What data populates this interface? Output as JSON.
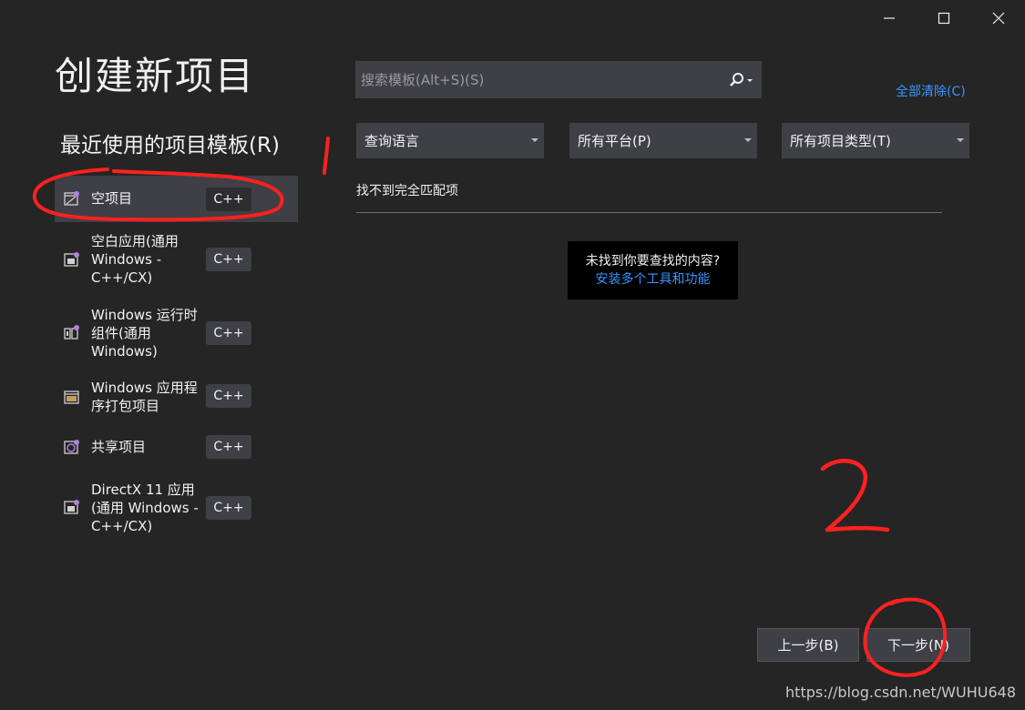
{
  "window": {
    "title": "创建新项目",
    "controls": [
      "minimize-icon",
      "maximize-icon",
      "close-icon"
    ]
  },
  "recent": {
    "heading": "最近使用的项目模板(R)",
    "items": [
      {
        "label": "空项目",
        "tag": "C++",
        "icon": "empty-project-icon",
        "selected": true
      },
      {
        "label": "空白应用(通用 Windows - C++/CX)",
        "tag": "C++",
        "icon": "blank-app-icon",
        "selected": false
      },
      {
        "label": "Windows 运行时组件(通用 Windows)",
        "tag": "C++",
        "icon": "runtime-component-icon",
        "selected": false
      },
      {
        "label": "Windows 应用程序打包项目",
        "tag": "C++",
        "icon": "packaging-project-icon",
        "selected": false
      },
      {
        "label": "共享项目",
        "tag": "C++",
        "icon": "shared-project-icon",
        "selected": false
      },
      {
        "label": "DirectX 11 应用(通用 Windows - C++/CX)",
        "tag": "C++",
        "icon": "directx-app-icon",
        "selected": false
      }
    ]
  },
  "search": {
    "placeholder": "搜索模板(Alt+S)(S)",
    "icon": "search-icon"
  },
  "filters": {
    "clear_all": "全部清除(C)",
    "language": "查询语言",
    "platform": "所有平台(P)",
    "project_type": "所有项目类型(T)"
  },
  "results": {
    "no_match": "找不到完全匹配项"
  },
  "tooltip": {
    "question": "未找到你要查找的内容?",
    "link": "安装多个工具和功能"
  },
  "footer": {
    "back": "上一步(B)",
    "next": "下一步(N)"
  },
  "annotations": {
    "one": "1",
    "two": "2"
  },
  "watermark": "https://blog.csdn.net/WUHU648",
  "colors": {
    "background": "#252526",
    "panel": "#3f3f46",
    "link": "#3794ff",
    "annotation": "#ff2020"
  }
}
